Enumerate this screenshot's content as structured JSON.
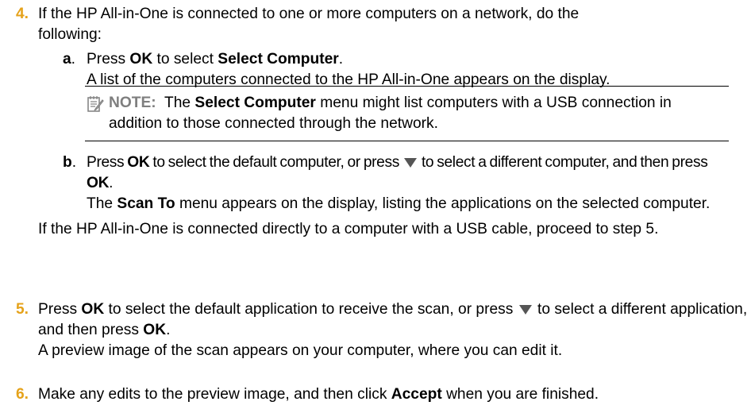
{
  "step4": {
    "number": "4.",
    "intro": "If the HP All-in-One is connected to one or more computers on a network, do the following:",
    "a": {
      "letter": "a",
      "period": ".",
      "pre": "Press ",
      "ok": "OK",
      "mid": " to select ",
      "select_computer": "Select Computer",
      "end": ".",
      "line2": "A list of the computers connected to the HP All-in-One appears on the display."
    },
    "note": {
      "icon": "note-icon",
      "label": "NOTE:",
      "pre": "  The ",
      "menu": "Select Computer",
      "post": " menu might list computers with a USB connection in addition to those connected through the network."
    },
    "b": {
      "letter": "b",
      "period": ".",
      "pre": "Press ",
      "ok": "OK",
      "mid": " to select the default computer, or press ",
      "arrow_icon": "down-arrow-icon",
      "mid2": " to select a different computer, and then press ",
      "ok2": "OK",
      "end": ".",
      "scan_to": "Scan To",
      "line2": " menu appears on the display, listing the applications on the selected computer.",
      "line2_pre": "The "
    },
    "usb_text": "If the HP All-in-One is connected directly to a computer with a USB cable, proceed to step 5."
  },
  "step5": {
    "number": "5.",
    "pre": "Press ",
    "ok": "OK",
    "mid": " to select the default application to receive the scan, or press ",
    "arrow_icon": "down-arrow-icon",
    "mid2": " to select a different application, and then press ",
    "ok2": "OK",
    "end": ".",
    "line2": "A preview image of the scan appears on your computer, where you can edit it."
  },
  "step6": {
    "number": "6.",
    "pre": "Make any edits to the preview image, and then click ",
    "accept": "Accept",
    "post": " when you are finished."
  }
}
